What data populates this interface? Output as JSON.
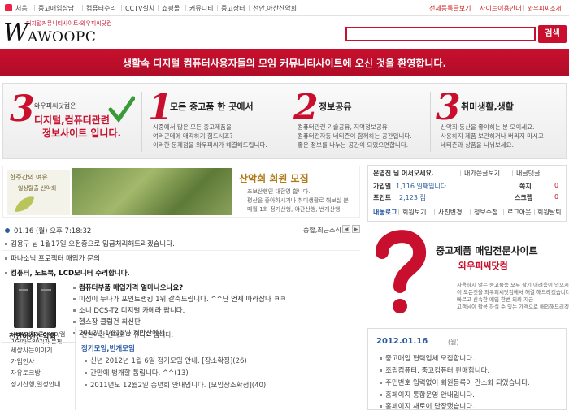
{
  "topnav": {
    "items": [
      "처음",
      "중고매입상담",
      "컴퓨터수리",
      "CCTV설치",
      "쇼핑몰",
      "커뮤니티",
      "중고장터",
      "천안,아산산악회"
    ],
    "right": [
      "전체등록글보기",
      "사이트이용안내",
      "와우피씨소개"
    ]
  },
  "logo": {
    "sub": "디지털커뮤니티사이트-와우피씨닷컴",
    "w": "W",
    "rest": "AWOOPC"
  },
  "search": {
    "placeholder": "",
    "button": "검색"
  },
  "banner": "생활속 디지털 컴퓨터사용자들의 모임 커뮤니티사이트에 오신 것을 환영합니다.",
  "features": [
    {
      "num": "3",
      "line1": "와우피씨닷컴은",
      "line2": "디지털,컴퓨터관련",
      "line3": "정보사이트 입니다."
    },
    {
      "num": "1",
      "title": "모든 중고품 한 곳에서",
      "desc": [
        "시중에서 많은 모든 중고제품을",
        "여러군데에 매각하기 힘드시죠?",
        "이러한 문제점을 와우피씨가 해결해드립니다."
      ]
    },
    {
      "num": "2",
      "title": "정보공유",
      "desc": [
        "컴퓨터관련 기술공유, 지역정보공유",
        "컴퓨터전자등 네티즌이 함께하는 공간입니다.",
        "좋은 정보를 나누는 공간이 되었으면합니다."
      ]
    },
    {
      "num": "3",
      "title": "취미생활,생활",
      "desc": [
        "산악회·등산을 좋아하는 분 모이세요.",
        "사용하지 제품 보관하거나 버리지 마시고",
        "네티즌과 상품을 나눠보세요."
      ]
    }
  ],
  "club": {
    "tag1": "한주간의 여유",
    "tag2": "일상탈출 산악회",
    "title": "산악회 회원 모집",
    "desc": [
      "초보산행인 대환영 합니다.",
      "평산을 좋아하시거나 취미생활로 해보실 분",
      "매월 1회 정기산행, 야간산행, 번개산행"
    ]
  },
  "login": {
    "greet": "운영진 님 어서오세요.",
    "links": [
      "내가쓴글보기",
      "내글댓글"
    ],
    "joined_label": "가입일",
    "joined": "1,116 일째입니다.",
    "msg_label": "쪽지",
    "msg": "0",
    "point_label": "포인트",
    "point": "2,123 점",
    "scrap_label": "스크랩",
    "scrap": "0",
    "actions": [
      "내놓로그",
      "회원보기",
      "사진변경",
      "정보수정",
      "로그아웃",
      "회원탈퇴"
    ]
  },
  "datebar": {
    "time": "01.16 (월) 오후 7:18:32",
    "label": "종합,최근소식"
  },
  "news": [
    "김용구 님 1월17일 오전중으로 입금처리해드리겠습니다.",
    "파나소닉 프로젝터 매입가 문의",
    "컴퓨터, 노트북, LCD모니터 수리합니다.",
    "컴퓨터부품 매입가격 얼마나오나요?",
    "미성이 누나가 포인트랭킹 1위 갈축드립니다. ^^난 언제 따라잡나 ㅋㅋ",
    "소니 DCS-T2 디지털 카메라 팝니다.",
    "헬스장 클럽건 최신판",
    "2012년 1월15일 계방산에서"
  ],
  "product": {
    "cap1": "AMD셈프론3400/램",
    "cap2": "1G/하드80기가 본체"
  },
  "club_side": {
    "title": "천안아산산악회",
    "items": [
      "세상사는이야기",
      "가입인사",
      "자유토크방",
      "정기산행,일정안내"
    ]
  },
  "club_main": {
    "intro": "천안아산 산악회 커뮤니티 입니다.",
    "header": "정기모임,번개모임",
    "posts": [
      "신년 2012년 1월 6일 정기모임 안내. [장소확정](26)",
      "간만에 벙개할 톱립니다. ^^(13)",
      "2011년도 12월2일 송년회 안내입니다. [모임장소확정](40)"
    ]
  },
  "ad": {
    "head1": "중고제품 매입전문사이트",
    "head2": "와우피씨닷컴",
    "desc": [
      "사용하지 않는 중고물품 모두 팔기 어려움이 있으시죠?",
      "이 모든것을 와우피씨닷컴에서 해결 해드리겠습니다.",
      "빠르고 신속한 매입 한번 의뢰 지금",
      "고객님이 활용 하실 수 있는 가격으로 매입해드리겠습니다."
    ]
  },
  "notice": {
    "date": "2012.01.16",
    "weekday": "(월)",
    "items": [
      "중고매입 협력업체 모집합니다.",
      "조립컴퓨터, 중고컴퓨터 판매합니다.",
      "주민번호 입력없이 회원등록이 간소화 되었습니다.",
      "홈페이지 통합운영 안내입니다.",
      "홈페이지 새로이 단장했습니다."
    ]
  },
  "colors": {
    "brand_red": "#c8102e",
    "link_blue": "#2c5aa0"
  }
}
